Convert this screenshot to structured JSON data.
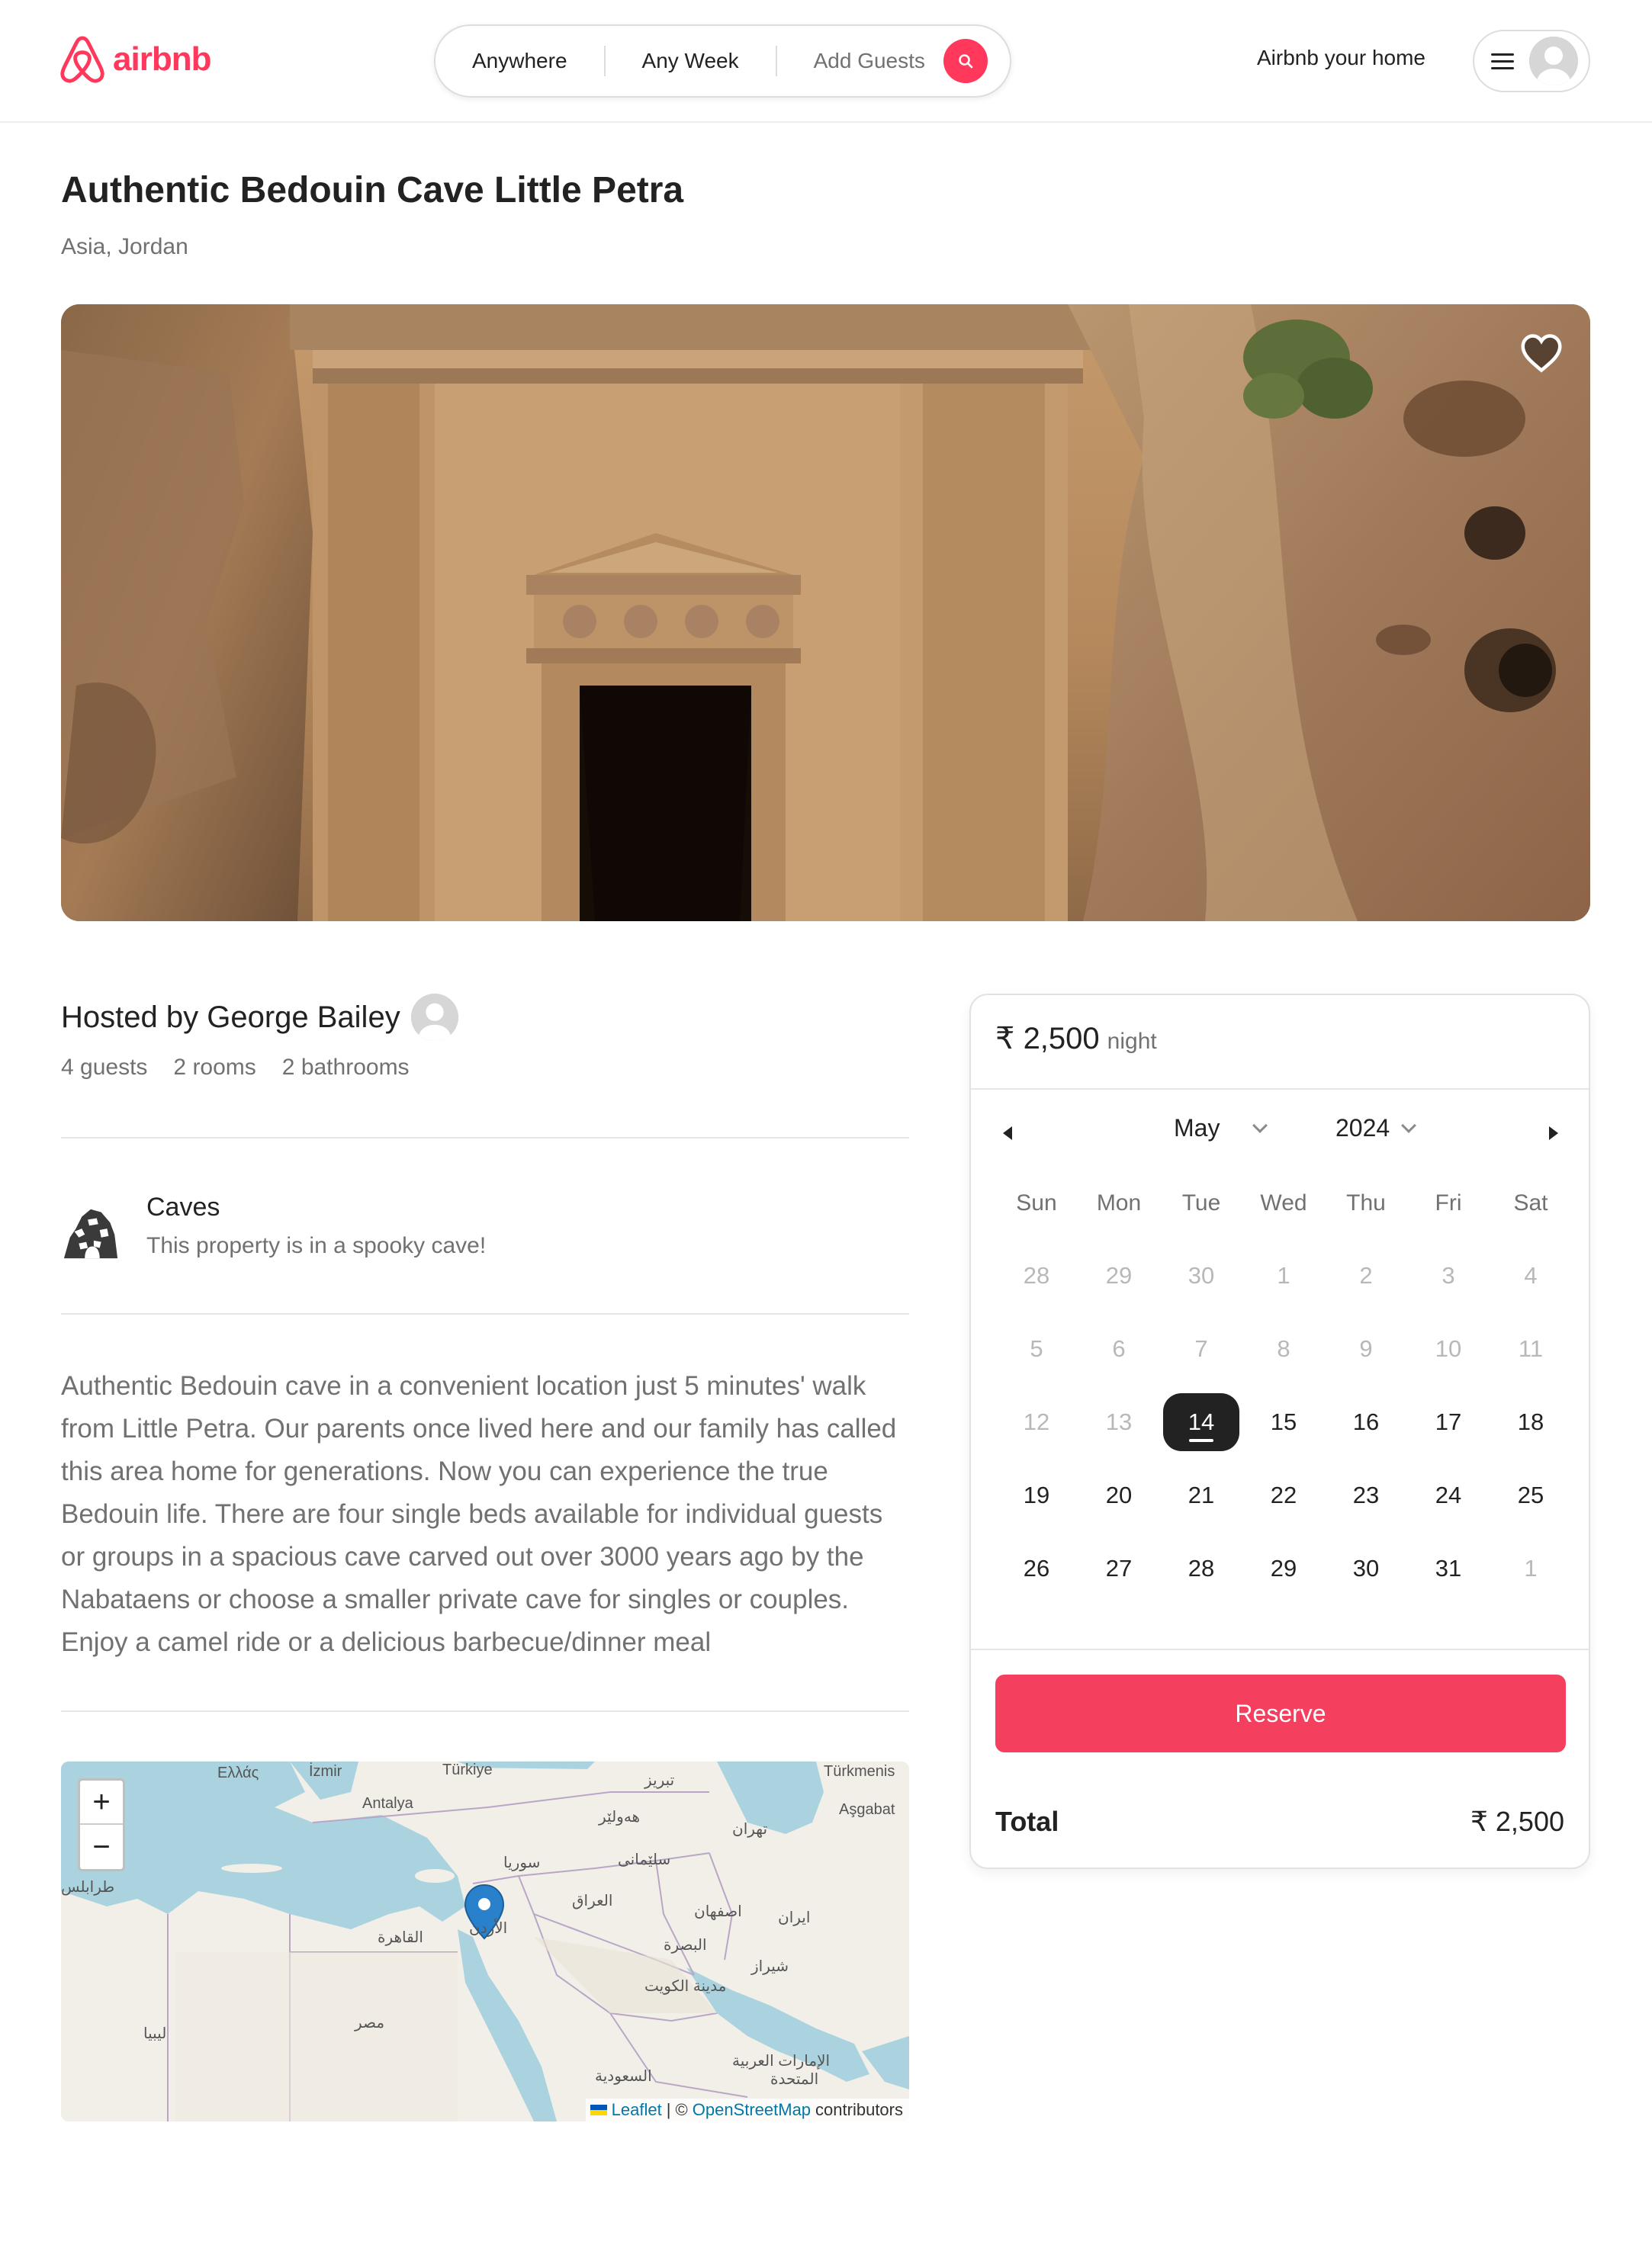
{
  "brand": {
    "name": "airbnb",
    "color": "#ff385c"
  },
  "search": {
    "where": "Anywhere",
    "when": "Any Week",
    "who": "Add Guests",
    "search_icon": "search-icon"
  },
  "nav": {
    "host_link": "Airbnb your home",
    "menu_icon": "hamburger-icon",
    "avatar_icon": "user-avatar-icon"
  },
  "listing": {
    "title": "Authentic Bedouin Cave Little Petra",
    "location": "Asia, Jordan",
    "favorite_icon": "heart-icon",
    "host": "Hosted by George Bailey",
    "stats": [
      "4 guests",
      "2 rooms",
      "2 bathrooms"
    ],
    "category": {
      "icon": "caves-icon",
      "title": "Caves",
      "description": "This property is in a spooky cave!"
    },
    "description": "Authentic Bedouin cave in a convenient location just 5 minutes' walk from Little Petra. Our parents once lived here and our family has called this area home for generations. Now you can experience the true Bedouin life. There are four single beds available for individual guests or groups in a spacious cave carved out over 3000 years ago by the Nabataens or choose a smaller private cave for singles or couples. Enjoy a camel ride or a delicious barbecue/dinner meal"
  },
  "map": {
    "zoom_in": "+",
    "zoom_out": "−",
    "attribution_leaflet": "Leaflet",
    "attribution_sep": "| ©",
    "attribution_osm": "OpenStreetMap",
    "attribution_tail": "contributors",
    "labels": [
      "Ελλάς",
      "İzmir",
      "Türkiye",
      "Türkmenis",
      "Aşgabat",
      "Antalya",
      "تبريز",
      "هەولێر",
      "تهران",
      "سوريا",
      "سلێمانی",
      "طرابلس",
      "العراق",
      "اصفهان",
      "ایران",
      "القاهرة",
      "الأردن",
      "البصرة",
      "شيراز",
      "مدينة الكويت",
      "مصر",
      "ليبيا",
      "السعودية",
      "الإمارات العربية",
      "المتحدة"
    ]
  },
  "booking": {
    "price": "₹ 2,500",
    "price_unit": "night",
    "calendar": {
      "month": "May",
      "year": "2024",
      "weekdays": [
        "Sun",
        "Mon",
        "Tue",
        "Wed",
        "Thu",
        "Fri",
        "Sat"
      ],
      "weeks": [
        [
          "28",
          "29",
          "30",
          "1",
          "2",
          "3",
          "4"
        ],
        [
          "5",
          "6",
          "7",
          "8",
          "9",
          "10",
          "11"
        ],
        [
          "12",
          "13",
          "14",
          "15",
          "16",
          "17",
          "18"
        ],
        [
          "19",
          "20",
          "21",
          "22",
          "23",
          "24",
          "25"
        ],
        [
          "26",
          "27",
          "28",
          "29",
          "30",
          "31",
          "1"
        ]
      ],
      "selected_day": "14"
    },
    "reserve_label": "Reserve",
    "total_label": "Total",
    "total_value": "₹ 2,500",
    "accent_color": "#f43f5e"
  }
}
